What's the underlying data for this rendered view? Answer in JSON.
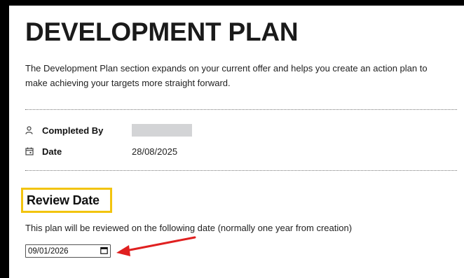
{
  "page": {
    "title": "DEVELOPMENT PLAN",
    "description": "The Development Plan section expands on your current offer and helps you create an action plan to make achieving your targets more straight forward."
  },
  "meta": {
    "completed_by": {
      "label": "Completed By",
      "icon": "person-icon",
      "value": ""
    },
    "date": {
      "label": "Date",
      "icon": "calendar-icon",
      "value": "28/08/2025"
    }
  },
  "review": {
    "heading": "Review Date",
    "text": "This plan will be reviewed on the following date (normally one year from creation)",
    "input_value": "09/01/2026",
    "input_icon": "calendar-picker-icon"
  },
  "colors": {
    "highlight": "#f2c40f",
    "annotation_arrow": "#e02020",
    "redaction": "#d3d4d6"
  }
}
